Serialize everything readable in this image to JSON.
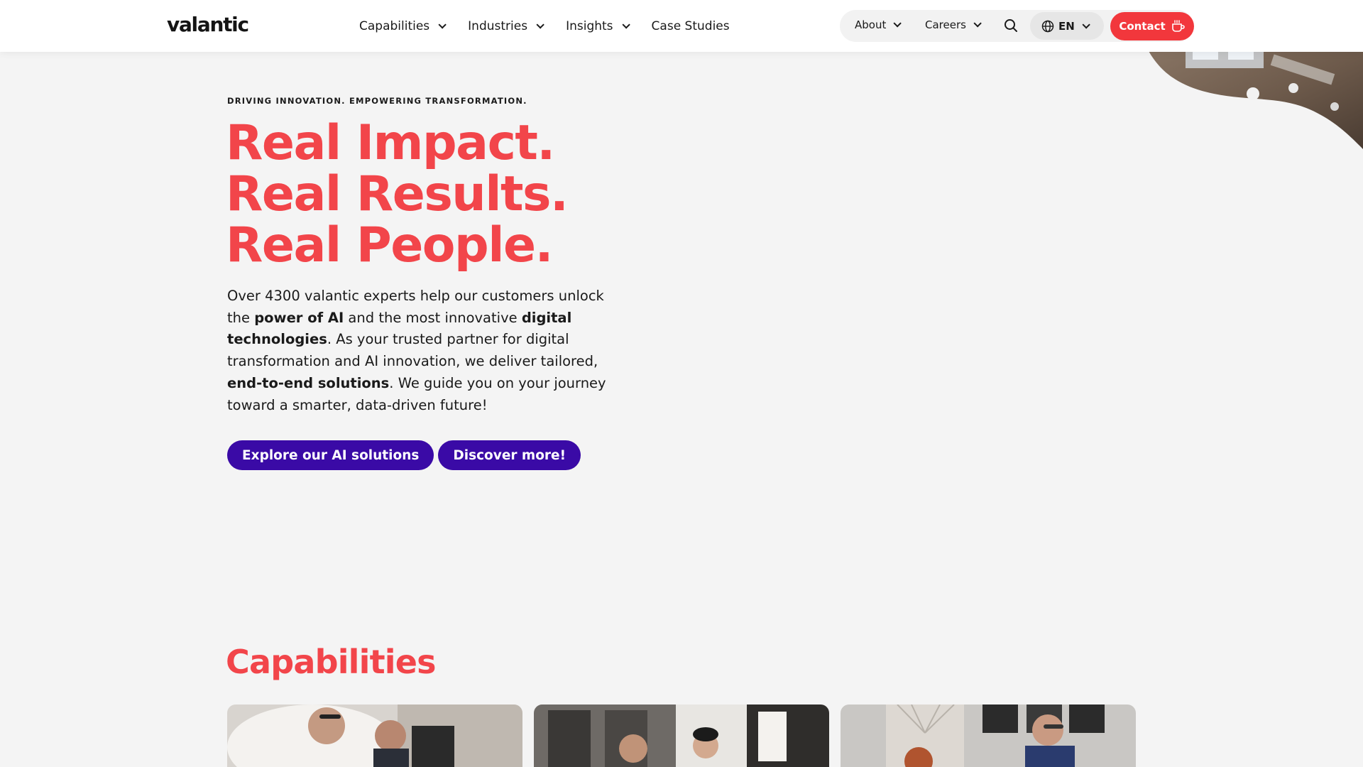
{
  "header": {
    "logo": "valantic",
    "nav": [
      {
        "label": "Capabilities"
      },
      {
        "label": "Industries"
      },
      {
        "label": "Insights"
      },
      {
        "label": "Case Studies"
      }
    ],
    "util": {
      "about": "About",
      "careers": "Careers",
      "language": "EN",
      "contact": "Contact"
    }
  },
  "hero": {
    "eyebrow": "DRIVING INNOVATION. EMPOWERING TRANSFORMATION.",
    "headline": [
      "Real Impact.",
      "Real Results.",
      "Real People."
    ],
    "intro": {
      "p1": "Over 4300 valantic experts help our customers unlock the ",
      "b1": "power of AI",
      "p2": " and the most innovative ",
      "b2": "digital technologies",
      "p3": ". As your trusted partner for digital transformation and AI innovation, we deliver tailored, ",
      "b3": "end-to-end solutions",
      "p4": ". We guide you on your journey toward a smarter, data-driven future!"
    },
    "cta_primary": "Explore our AI solutions",
    "cta_secondary": "Discover more!"
  },
  "capabilities": {
    "title": "Capabilities"
  },
  "colors": {
    "brand_red": "#f2454a",
    "contact_red": "#f2373c",
    "cta_purple": "#3a0aa6",
    "page_bg": "#f4f4f4"
  }
}
